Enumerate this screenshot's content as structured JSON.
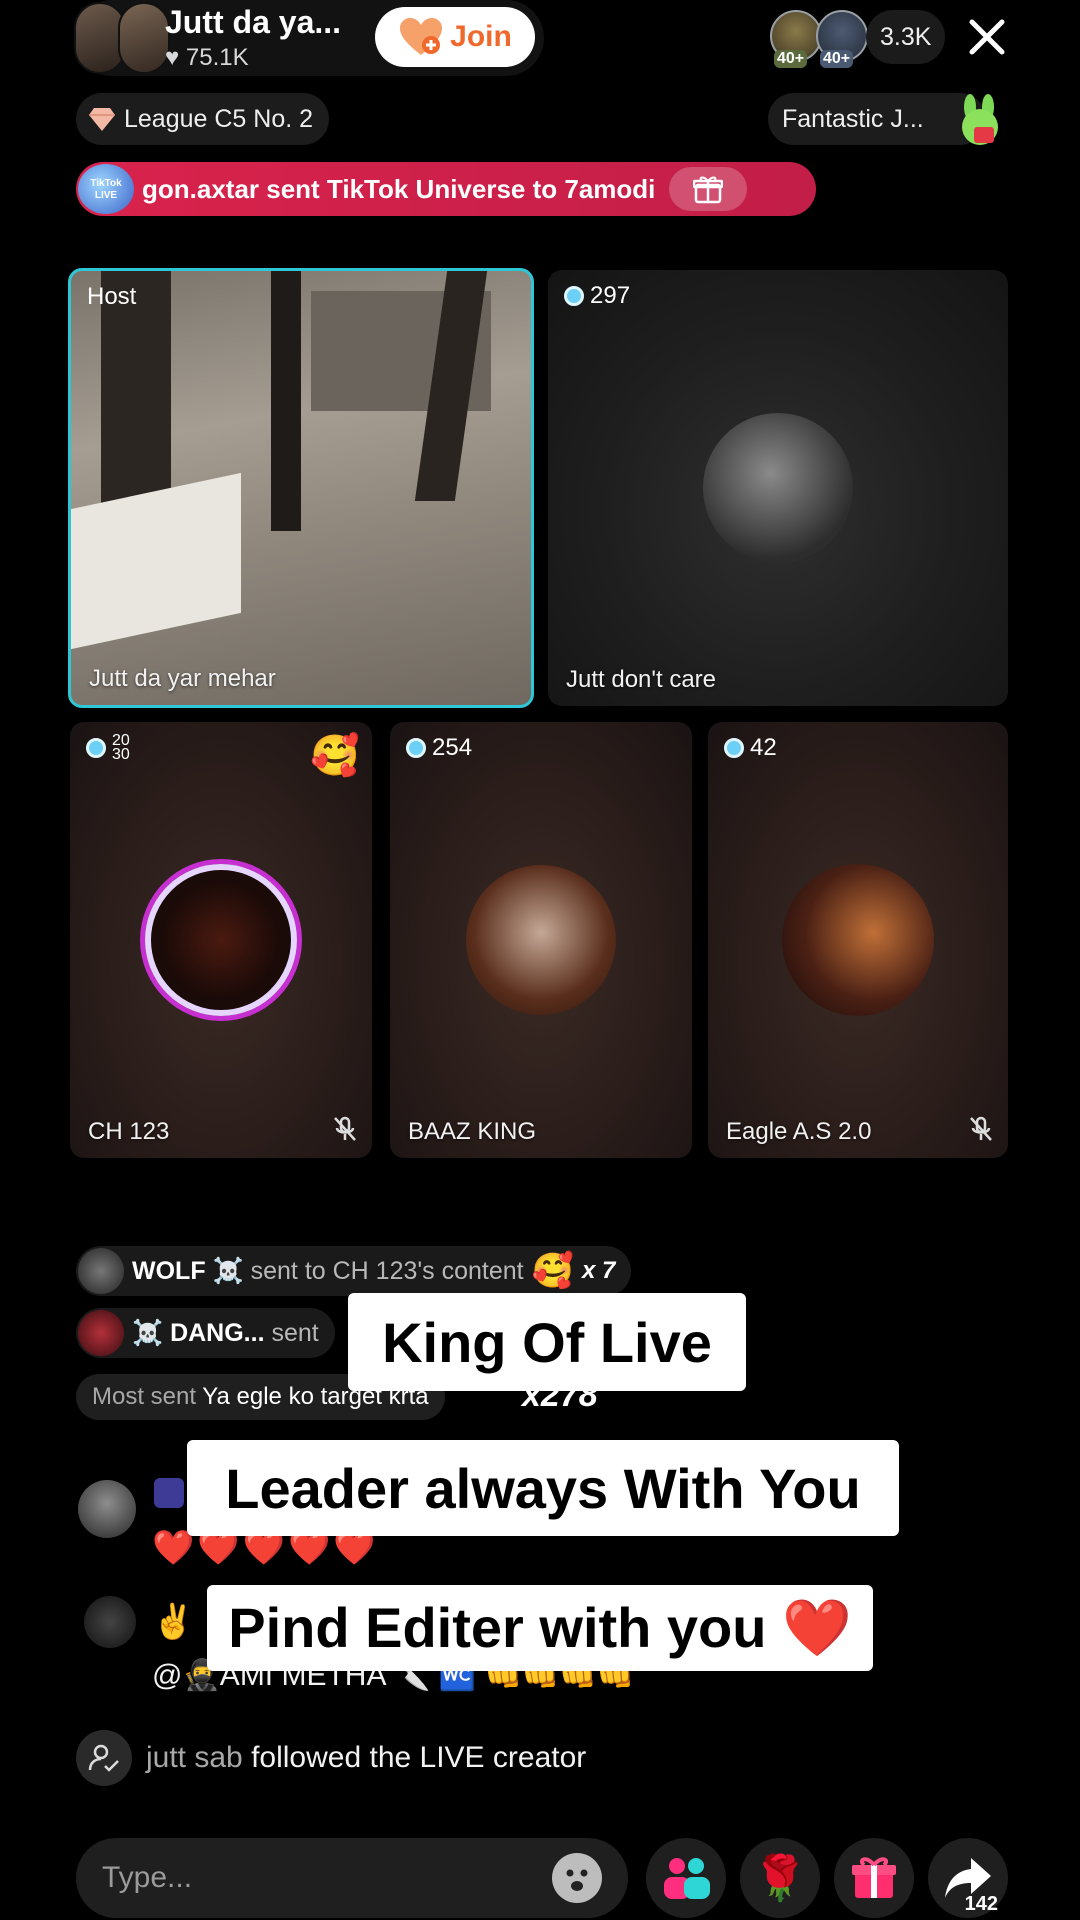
{
  "header": {
    "host_name": "Jutt da ya...",
    "host_likes": "75.1K",
    "join_label": "Join",
    "viewer_badge_1": "40+",
    "viewer_badge_2": "40+",
    "viewer_count": "3.3K"
  },
  "league": {
    "label": "League C5 No. 2"
  },
  "fantastic": {
    "label": "Fantastic J..."
  },
  "gift_banner": {
    "text": "gon.axtar sent TikTok Universe to 7amodi",
    "icon_text": "TikTok LIVE"
  },
  "tiles": [
    {
      "tag": "Host",
      "name": "Jutt da yar mehar"
    },
    {
      "score": "297",
      "name": "Jutt  don't  care"
    },
    {
      "score": "20 30",
      "name": "CH 123"
    },
    {
      "score": "254",
      "name": "BAAZ KING"
    },
    {
      "score": "42",
      "name": "Eagle A.S 2.0"
    }
  ],
  "gift_rows": [
    {
      "sender": "WOLF ☠️",
      "text": "sent to CH 123's content",
      "mult": "x 7"
    },
    {
      "sender": "☠️  DANG...",
      "text": "sent"
    }
  ],
  "most_sent": {
    "prefix": "Most sent",
    "text": "Ya egle ko target krta"
  },
  "combo": "x278",
  "comments": {
    "hearts": "❤️❤️❤️❤️❤️",
    "peace": "✌️",
    "mention": "@🥷AMI METHA 🔪 🚾 👊👊👊👊"
  },
  "follow": {
    "user": "jutt sab",
    "text": "followed the LIVE creator"
  },
  "captions": {
    "cap1": "King Of Live",
    "cap2": "Leader always With You",
    "cap3": "Pind Editer with you ❤️"
  },
  "bottom": {
    "placeholder": "Type...",
    "share_count": "142"
  },
  "colors": {
    "accent_cyan": "#2fc7d6",
    "banner_red": "#d9234c",
    "join_orange": "#f0682c"
  }
}
